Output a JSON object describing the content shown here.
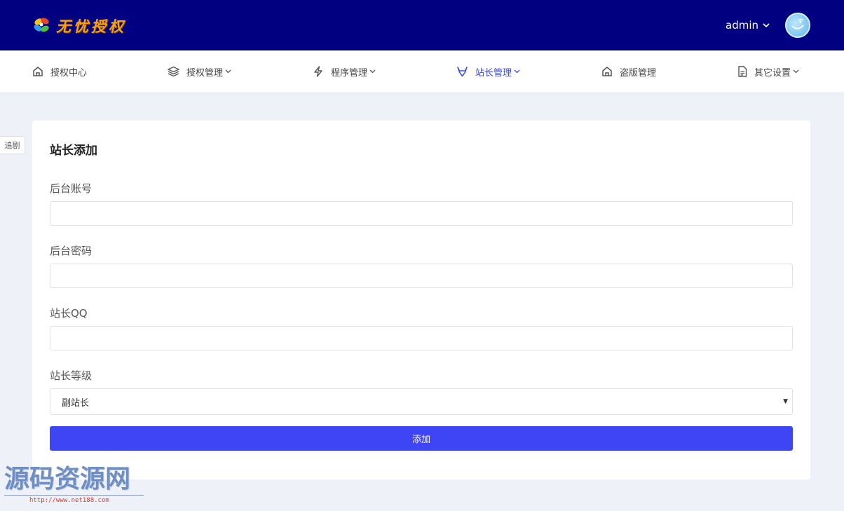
{
  "header": {
    "logo_text": "无忧授权",
    "username": "admin"
  },
  "nav": {
    "items": [
      {
        "label": "授权中心",
        "icon": "home-icon",
        "has_dropdown": false,
        "active": false
      },
      {
        "label": "授权管理",
        "icon": "layers-icon",
        "has_dropdown": true,
        "active": false
      },
      {
        "label": "程序管理",
        "icon": "bolt-icon",
        "has_dropdown": true,
        "active": false
      },
      {
        "label": "站长管理",
        "icon": "gitlab-icon",
        "has_dropdown": true,
        "active": true
      },
      {
        "label": "盗版管理",
        "icon": "home-icon",
        "has_dropdown": false,
        "active": false
      },
      {
        "label": "其它设置",
        "icon": "document-icon",
        "has_dropdown": true,
        "active": false
      }
    ]
  },
  "side_tab": {
    "label": "追剧"
  },
  "form": {
    "title": "站长添加",
    "fields": [
      {
        "label": "后台账号",
        "value": ""
      },
      {
        "label": "后台密码",
        "value": ""
      },
      {
        "label": "站长QQ",
        "value": ""
      }
    ],
    "level": {
      "label": "站长等级",
      "selected": "副站长"
    },
    "submit_label": "添加"
  },
  "watermark": {
    "title": "源码资源网",
    "url": "http://www.net188.com"
  },
  "colors": {
    "topbar": "#000080",
    "accent": "#3d45f5",
    "active_nav": "#3e4bd8",
    "background": "#eef1f7"
  }
}
